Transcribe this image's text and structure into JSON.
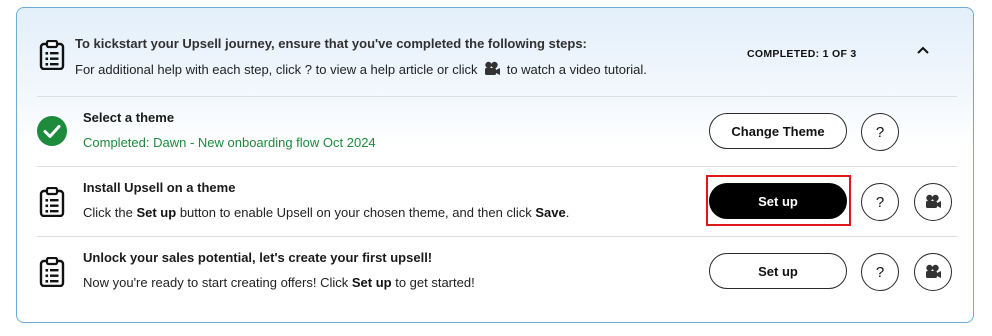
{
  "header": {
    "title": "To kickstart your Upsell journey, ensure that you've completed the following steps:",
    "help_prefix": "For additional help with each step, click ? to view a help article or click",
    "help_suffix": "to watch a video tutorial.",
    "progress": "COMPLETED: 1 OF 3",
    "collapse_icon": "chevron-up-icon"
  },
  "steps": [
    {
      "title": "Select a theme",
      "status_text": "Completed: Dawn - New onboarding flow Oct 2024",
      "button_label": "Change Theme",
      "help_label": "?",
      "icon": "check-circle-icon",
      "status_color": "#1f8a3d"
    },
    {
      "title": "Install Upsell on a theme",
      "desc_part1": "Click the ",
      "desc_bold1": "Set up",
      "desc_part2": " button to enable Upsell on your chosen theme, and then click ",
      "desc_bold2": "Save",
      "desc_part3": ".",
      "button_label": "Set up",
      "help_label": "?",
      "icon": "clipboard-icon",
      "video_icon": "video-camera-icon"
    },
    {
      "title": "Unlock your sales potential, let's create your first upsell!",
      "desc_part1": "Now you're ready to start creating offers! Click ",
      "desc_bold1": "Set up",
      "desc_part2": " to get started!",
      "button_label": "Set up",
      "help_label": "?",
      "icon": "clipboard-icon",
      "video_icon": "video-camera-icon"
    }
  ],
  "colors": {
    "accent_border": "#6aaed4",
    "primary_button": "#000000",
    "highlight": "#e0161b",
    "success": "#1f8a3d"
  }
}
